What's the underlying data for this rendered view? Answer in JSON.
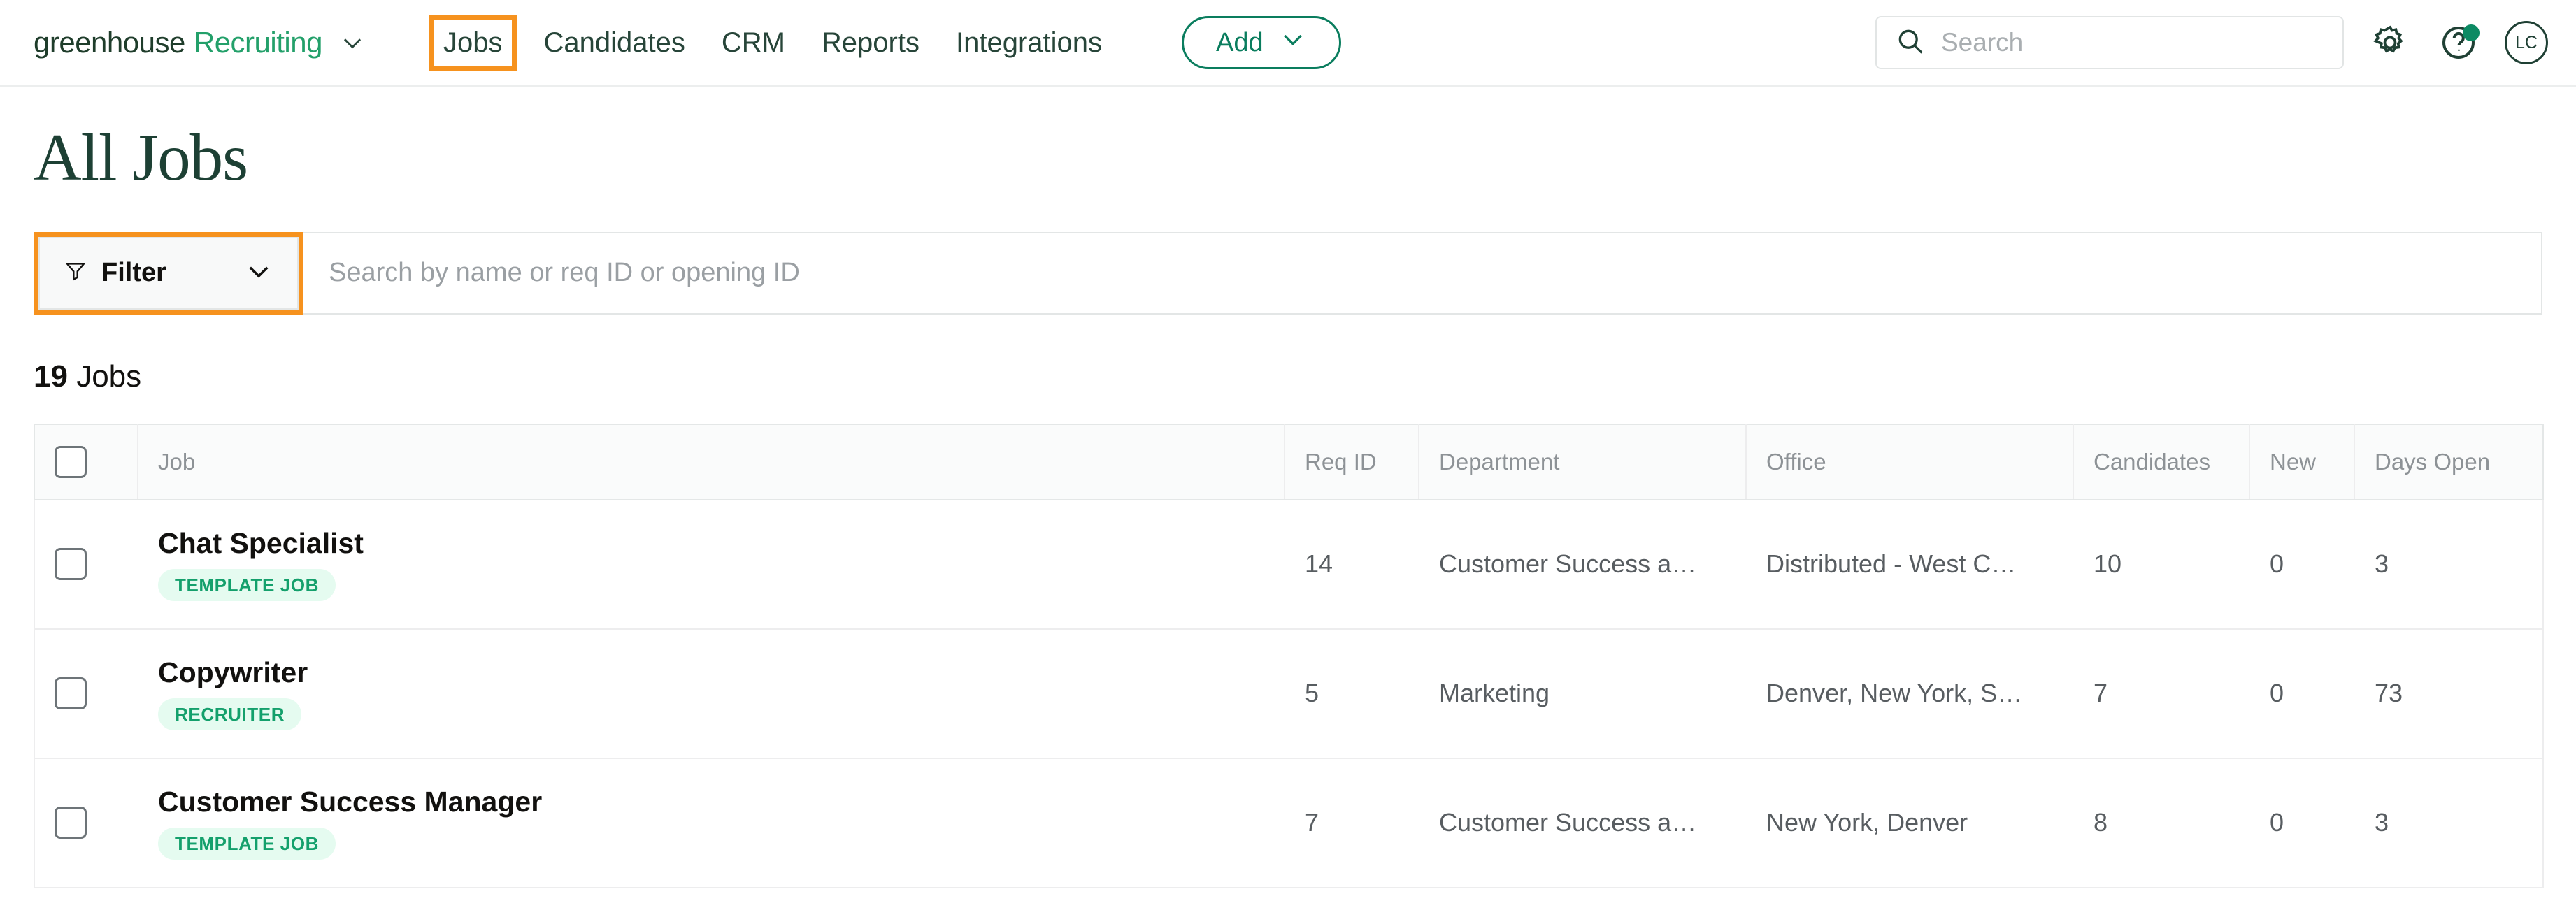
{
  "nav": {
    "brand": {
      "primary": "greenhouse",
      "secondary": "Recruiting"
    },
    "links": [
      {
        "label": "Jobs",
        "highlighted": true
      },
      {
        "label": "Candidates",
        "highlighted": false
      },
      {
        "label": "CRM",
        "highlighted": false
      },
      {
        "label": "Reports",
        "highlighted": false
      },
      {
        "label": "Integrations",
        "highlighted": false
      }
    ],
    "add_button": "Add",
    "search_placeholder": "Search",
    "avatar_initials": "LC",
    "icons": {
      "brand_caret": "chevron-down-icon",
      "add_caret": "chevron-down-icon",
      "search": "search-icon",
      "settings": "gear-icon",
      "help": "help-circle-icon",
      "notification": "notification-dot"
    }
  },
  "page": {
    "title": "All Jobs"
  },
  "filter_bar": {
    "filter_label": "Filter",
    "filter_icon": "funnel-icon",
    "filter_caret": "chevron-down-icon",
    "search_placeholder": "Search by name or req ID or opening ID",
    "search_value": ""
  },
  "results": {
    "count": "19",
    "count_label": "Jobs"
  },
  "table": {
    "columns": [
      {
        "key": "check",
        "label": ""
      },
      {
        "key": "job",
        "label": "Job"
      },
      {
        "key": "req",
        "label": "Req ID"
      },
      {
        "key": "dept",
        "label": "Department"
      },
      {
        "key": "office",
        "label": "Office"
      },
      {
        "key": "cand",
        "label": "Candidates"
      },
      {
        "key": "new",
        "label": "New"
      },
      {
        "key": "days",
        "label": "Days Open"
      }
    ],
    "rows": [
      {
        "title": "Chat Specialist",
        "badge": "TEMPLATE JOB",
        "req_id": "14",
        "department": "Customer Success a…",
        "office": "Distributed - West C…",
        "candidates": "10",
        "new": "0",
        "days_open": "3"
      },
      {
        "title": "Copywriter",
        "badge": "RECRUITER",
        "req_id": "5",
        "department": "Marketing",
        "office": "Denver, New York, S…",
        "candidates": "7",
        "new": "0",
        "days_open": "73"
      },
      {
        "title": "Customer Success Manager",
        "badge": "TEMPLATE JOB",
        "req_id": "7",
        "department": "Customer Success a…",
        "office": "New York, Denver",
        "candidates": "8",
        "new": "0",
        "days_open": "3"
      }
    ]
  },
  "colors": {
    "brand_green": "#23a06a",
    "dark_green": "#1d4034",
    "accent_teal": "#0a7d5e",
    "highlight_orange": "#f6921e",
    "badge_bg": "#e5fbf0",
    "badge_text": "#14a06c"
  }
}
